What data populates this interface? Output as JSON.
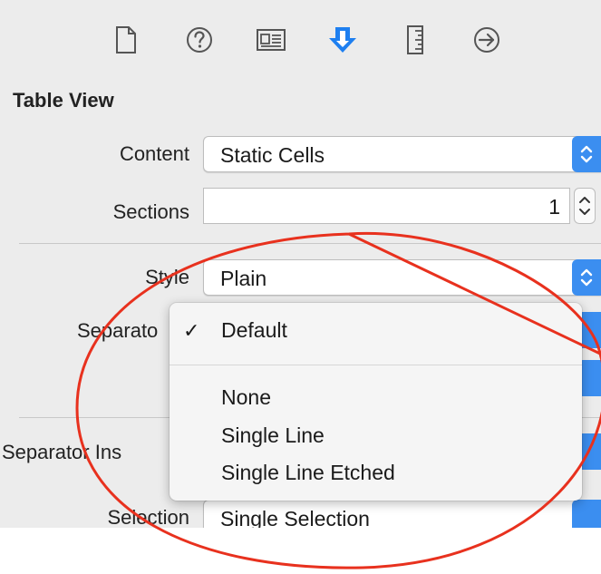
{
  "toolbar": {
    "tabs": [
      {
        "icon": "file-icon"
      },
      {
        "icon": "help-icon"
      },
      {
        "icon": "identity-icon"
      },
      {
        "icon": "attributes-inspector-icon",
        "selected": true
      },
      {
        "icon": "size-inspector-icon"
      },
      {
        "icon": "connections-icon"
      }
    ],
    "accent_color": "#3b8ef0"
  },
  "section": {
    "title": "Table View"
  },
  "content": {
    "label": "Content",
    "value": "Static Cells"
  },
  "sections": {
    "label": "Sections",
    "value": "1"
  },
  "style": {
    "label": "Style",
    "value": "Plain"
  },
  "separator": {
    "label": "Separato"
  },
  "separator_inset": {
    "label": "Separator Ins"
  },
  "selection": {
    "label": "Selection",
    "value": "Single Selection"
  },
  "menu": {
    "selected_item": "Default",
    "checkmark": "✓",
    "items": [
      "None",
      "Single Line",
      "Single Line Etched"
    ]
  },
  "annotation": {
    "color": "#e8311e"
  }
}
